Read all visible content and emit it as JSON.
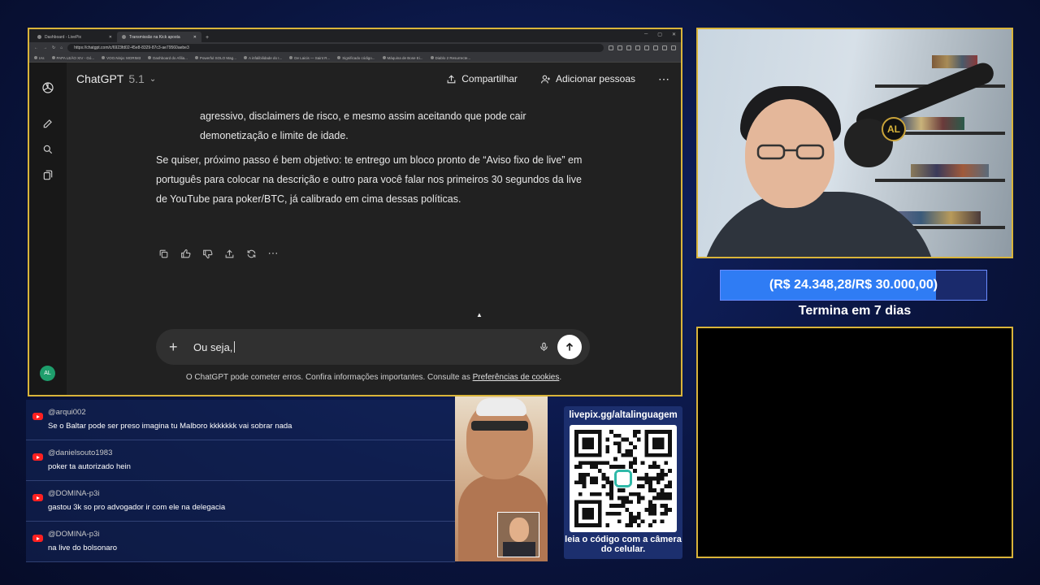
{
  "browser": {
    "tabs": [
      {
        "title": "Dashboard - LivePix",
        "active": false
      },
      {
        "title": "Transmissão na Kick aposta",
        "active": true
      }
    ],
    "url": "https://chatgpt.com/c/6923fd02-45e8-8329-87c3-ae79560aebe3",
    "bookmarks": [
      "IAs",
      "PAPA LEÃO XIV - Gó...",
      "VOO.Ninja: MORIM3",
      "Dashboard do Afilia...",
      "Powerful SOLO Mag...",
      "A infalibilidade do I...",
      "De Laicis — Saint R...",
      "Significado código...",
      "Máquina de Bose Ei...",
      "Diablo 2 Resurrecte..."
    ]
  },
  "chatgpt": {
    "model_name": "ChatGPT",
    "model_version": "5.1",
    "share_label": "Compartilhar",
    "add_people_label": "Adicionar pessoas",
    "avatar_initials": "AL",
    "message_partial": "agressivo, disclaimers de risco, e mesmo assim aceitando que pode cair demonetização e limite de idade.",
    "message_main": "Se quiser, próximo passo é bem objetivo: te entrego um bloco pronto de “Aviso fixo de live” em português para colocar na descrição e outro para você falar nos primeiros 30 segundos da live de YouTube para poker/BTC, já calibrado em cima dessas políticas.",
    "composer_text": "Ou seja,",
    "disclaimer_text": "O ChatGPT pode cometer erros. Confira informações importantes. Consulte as",
    "disclaimer_link": "Preferências de cookies",
    "disclaimer_end": "."
  },
  "goal": {
    "label": "(R$ 24.348,28/R$ 30.000,00)",
    "current": 24348.28,
    "target": 30000.0,
    "ends_label": "Termina em 7 dias"
  },
  "chat": [
    {
      "user": "@arqui002",
      "text": "Se o Baltar pode ser preso imagina tu Malboro kkkkkkk vai sobrar nada"
    },
    {
      "user": "@danielsouto1983",
      "text": "poker ta autorizado hein"
    },
    {
      "user": "@DOMINA-p3i",
      "text": "gastou 3k so pro advogador ir com ele na delegacia"
    },
    {
      "user": "@DOMINA-p3i",
      "text": "na live do bolsonaro"
    }
  ],
  "pix": {
    "url": "livepix.gg/altalinguagem",
    "caption": "leia o código com a câmera do celular."
  },
  "webcam": {
    "logo_text": "AL"
  },
  "colors": {
    "frame_gold": "#d9b43a",
    "goal_fill": "#2f7cf4",
    "youtube_red": "#ff2020"
  }
}
